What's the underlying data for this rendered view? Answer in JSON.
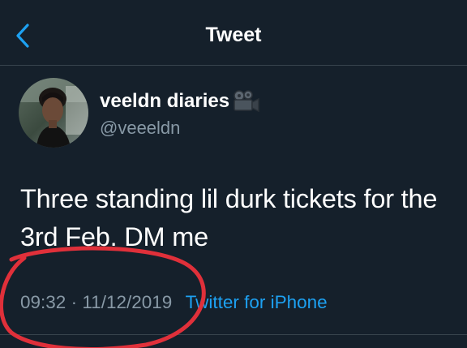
{
  "header": {
    "title": "Tweet",
    "back_icon": "chevron-left-icon"
  },
  "author": {
    "display_name": "veeldn diaries",
    "name_emoji_icon": "movie-camera-icon",
    "handle": "@veeeldn"
  },
  "tweet": {
    "text": "Three standing lil durk tickets for the\n3rd Feb. DM me",
    "time": "09:32",
    "separator": "·",
    "date": "11/12/2019",
    "source": "Twitter for iPhone"
  },
  "colors": {
    "background": "#15202b",
    "divider": "#38444d",
    "secondary_text": "#8899a6",
    "accent": "#1da1f2",
    "annotation": "#e0303a"
  }
}
